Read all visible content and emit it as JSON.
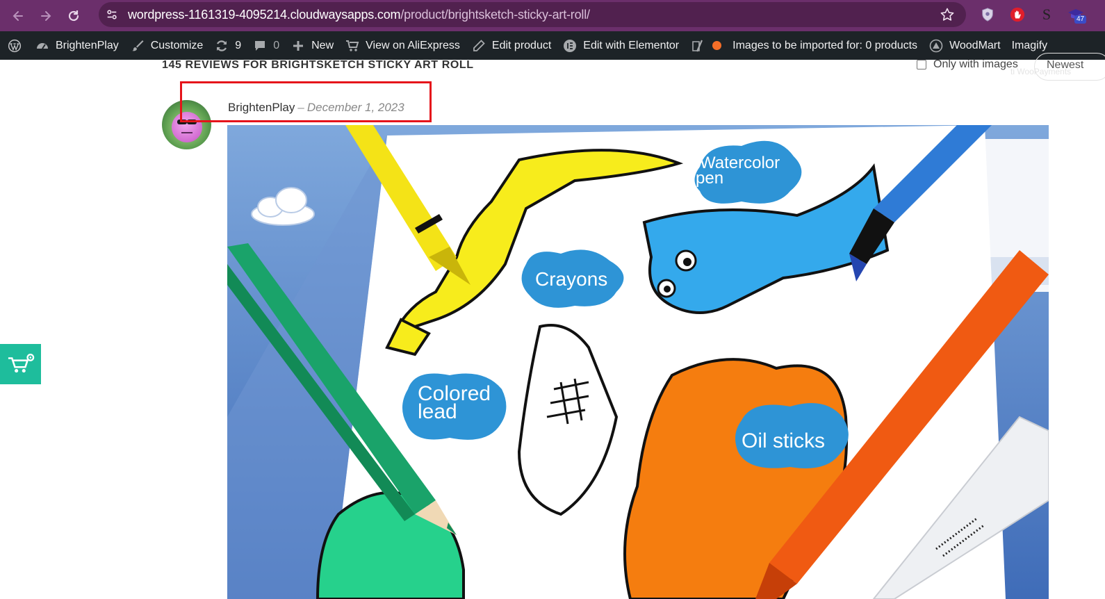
{
  "browser": {
    "url_host": "wordpress-1161319-4095214.cloudwaysapps.com",
    "url_path": "/product/brightsketch-sticky-art-roll/",
    "extension_badge": "47",
    "extension_letter": "S"
  },
  "admin_bar": {
    "site_name": "BrightenPlay",
    "customize": "Customize",
    "updates_count": "9",
    "comments_count": "0",
    "new": "New",
    "view_aliexpress": "View on AliExpress",
    "edit_product": "Edit product",
    "edit_elementor": "Edit with Elementor",
    "import_notice": "Images to be imported for: 0 products",
    "woodmart": "WoodMart",
    "imagify": "Imagify"
  },
  "reviews": {
    "title": "145 REVIEWS FOR BRIGHTSKETCH STICKY ART ROLL",
    "only_images_label": "Only with images",
    "sort_label": "Newest",
    "watermark": "ti WooPayments"
  },
  "review": {
    "author": "BrightenPlay",
    "separator": "–",
    "date": "December 1, 2023"
  },
  "image_labels": {
    "watercolor_line1": "Watercolor",
    "watercolor_line2": "pen",
    "crayons": "Crayons",
    "colored_line1": "Colored",
    "colored_line2": "lead",
    "oil_sticks": "Oil sticks"
  },
  "colors": {
    "browser_bar": "#6b2f6b",
    "omnibox": "#51214f",
    "admin_bar": "#1d2327",
    "highlight": "#e5141b",
    "widget": "#1ebd9c"
  }
}
